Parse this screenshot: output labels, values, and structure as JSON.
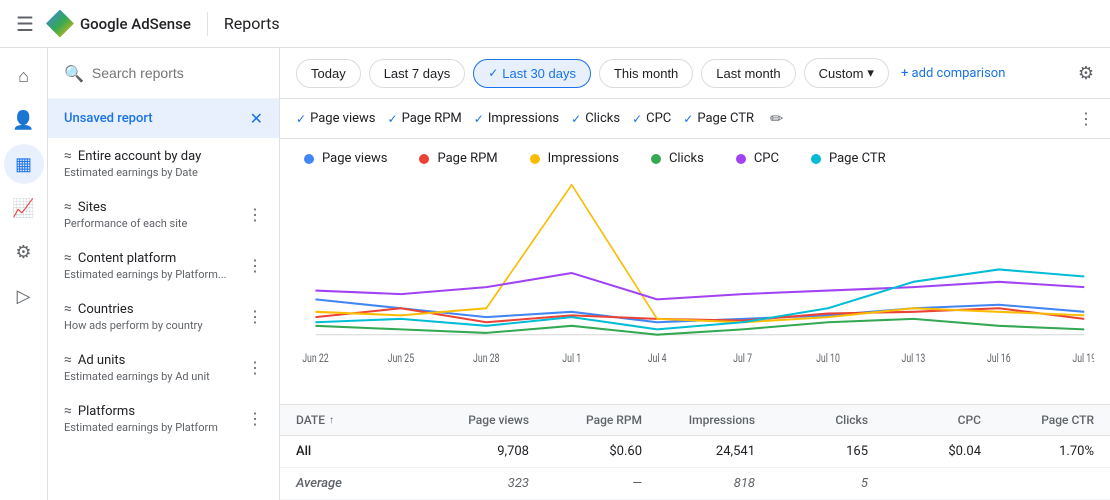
{
  "nav": {
    "hamburger": "☰",
    "logo_text": "Google AdSense",
    "page_title": "Reports"
  },
  "icon_sidebar": {
    "items": [
      {
        "name": "home-icon",
        "icon": "⌂",
        "active": false
      },
      {
        "name": "person-icon",
        "icon": "👤",
        "active": false
      },
      {
        "name": "content-icon",
        "icon": "▦",
        "active": true
      },
      {
        "name": "chart-icon",
        "icon": "📈",
        "active": false
      },
      {
        "name": "settings-icon-left",
        "icon": "⚙",
        "active": false
      },
      {
        "name": "video-icon",
        "icon": "▷",
        "active": false
      }
    ]
  },
  "reports_sidebar": {
    "search_placeholder": "Search reports",
    "unsaved_label": "Unsaved report",
    "items": [
      {
        "title": "Entire account by day",
        "desc": "Estimated earnings by Date",
        "has_more": false
      },
      {
        "title": "Sites",
        "desc": "Performance of each site",
        "has_more": true
      },
      {
        "title": "Content platform",
        "desc": "Estimated earnings by Platform...",
        "has_more": true
      },
      {
        "title": "Countries",
        "desc": "How ads perform by country",
        "has_more": true
      },
      {
        "title": "Ad units",
        "desc": "Estimated earnings by Ad unit",
        "has_more": true
      },
      {
        "title": "Platforms",
        "desc": "Estimated earnings by Platform",
        "has_more": true
      }
    ]
  },
  "date_filters": {
    "buttons": [
      {
        "label": "Today",
        "active": false
      },
      {
        "label": "Last 7 days",
        "active": false
      },
      {
        "label": "Last 30 days",
        "active": true
      },
      {
        "label": "This month",
        "active": false
      },
      {
        "label": "Last month",
        "active": false
      },
      {
        "label": "Custom",
        "active": false,
        "has_dropdown": true
      }
    ],
    "add_comparison": "+ add comparison",
    "settings_icon": "⚙"
  },
  "metric_chips": {
    "items": [
      {
        "label": "Page views",
        "active": true
      },
      {
        "label": "Page RPM",
        "active": true
      },
      {
        "label": "Impressions",
        "active": true
      },
      {
        "label": "Clicks",
        "active": true
      },
      {
        "label": "CPC",
        "active": true
      },
      {
        "label": "Page CTR",
        "active": true
      }
    ]
  },
  "chart_legend": {
    "items": [
      {
        "label": "Page views",
        "color": "#4285f4"
      },
      {
        "label": "Page RPM",
        "color": "#ea4335"
      },
      {
        "label": "Impressions",
        "color": "#fbbc04"
      },
      {
        "label": "Clicks",
        "color": "#34a853"
      },
      {
        "label": "CPC",
        "color": "#a142f4"
      },
      {
        "label": "Page CTR",
        "color": "#00bcd4"
      }
    ]
  },
  "chart": {
    "x_labels": [
      "Jun 22",
      "Jun 25",
      "Jun 28",
      "Jul 1",
      "Jul 4",
      "Jul 7",
      "Jul 10",
      "Jul 13",
      "Jul 16",
      "Jul 19"
    ],
    "series": {
      "page_views": {
        "color": "#4285f4",
        "points": [
          55,
          50,
          45,
          48,
          42,
          44,
          46,
          50,
          52,
          48
        ]
      },
      "page_rpm": {
        "color": "#ea4335",
        "points": [
          45,
          50,
          42,
          46,
          44,
          43,
          47,
          48,
          50,
          44
        ]
      },
      "impressions": {
        "color": "#fbbc04",
        "points": [
          48,
          46,
          50,
          120,
          44,
          42,
          45,
          50,
          48,
          46
        ]
      },
      "clicks": {
        "color": "#34a853",
        "points": [
          40,
          38,
          36,
          40,
          35,
          38,
          42,
          44,
          40,
          38
        ]
      },
      "cpc": {
        "color": "#a142f4",
        "points": [
          60,
          58,
          62,
          70,
          55,
          58,
          60,
          62,
          65,
          62
        ]
      },
      "page_ctr": {
        "color": "#00bcd4",
        "points": [
          42,
          44,
          40,
          45,
          38,
          42,
          50,
          65,
          72,
          68
        ]
      }
    }
  },
  "table": {
    "headers": [
      {
        "label": "DATE",
        "sortable": true
      },
      {
        "label": "Page views"
      },
      {
        "label": "Page RPM"
      },
      {
        "label": "Impressions"
      },
      {
        "label": "Clicks"
      },
      {
        "label": "CPC"
      },
      {
        "label": "Page CTR"
      }
    ],
    "rows": [
      {
        "date": "All",
        "page_views": "9,708",
        "page_rpm": "$0.60",
        "impressions": "24,541",
        "clicks": "165",
        "cpc": "$0.04",
        "page_ctr": "1.70%",
        "italic": false
      },
      {
        "date": "Average",
        "page_views": "323",
        "page_rpm": "—",
        "impressions": "818",
        "clicks": "5",
        "cpc": "",
        "page_ctr": "",
        "italic": true
      }
    ]
  }
}
